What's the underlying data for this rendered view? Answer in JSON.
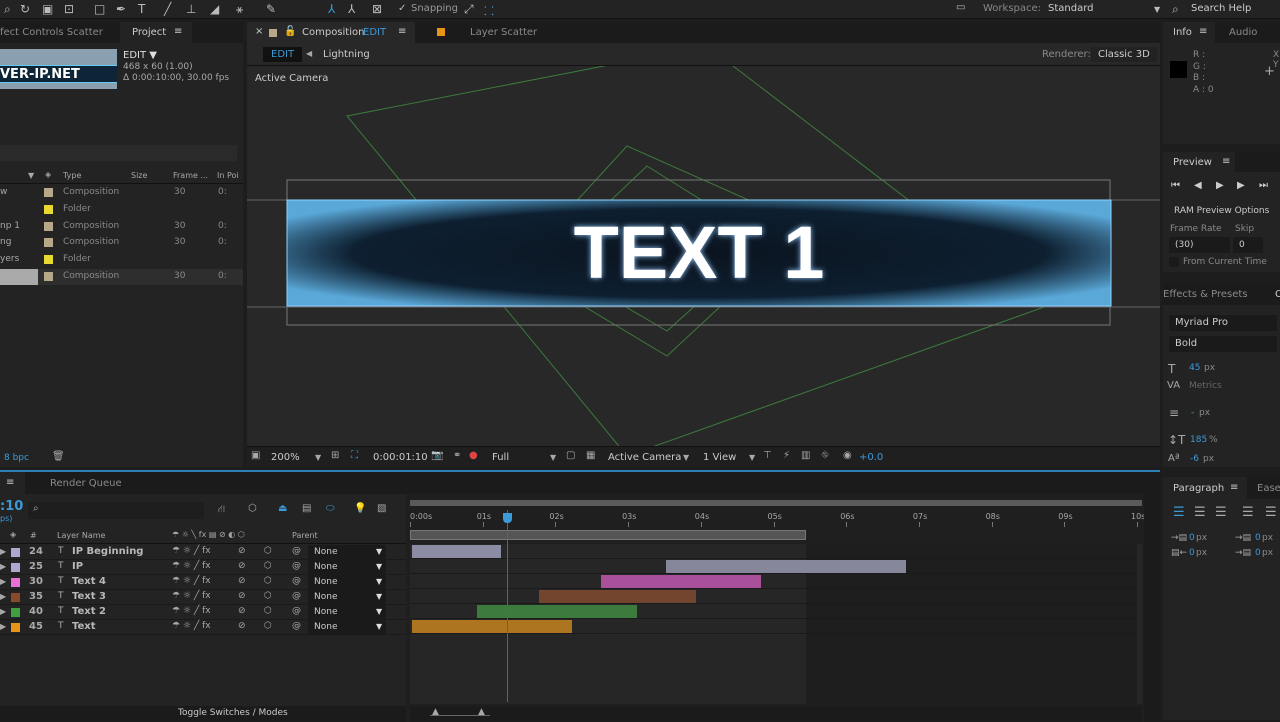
{
  "toolbar": {
    "snapping": "Snapping",
    "workspace_label": "Workspace:",
    "workspace": "Standard",
    "search": "Search Help"
  },
  "left": {
    "tab_effects": "fect Controls Scatter",
    "tab_project": "Project",
    "comp_name": "EDIT ▼",
    "comp_size": "468 x 60 (1.00)",
    "comp_duration": "Δ 0:00:10:00, 30.00 fps",
    "thumb_text": "VER-IP.NET",
    "columns": [
      "Type",
      "Size",
      "Frame ...",
      "In Poi"
    ],
    "items": [
      {
        "name": "w",
        "type": "Composition",
        "fr": "30",
        "in": "0:",
        "color": "#b8a88a"
      },
      {
        "name": "",
        "type": "Folder",
        "fr": "",
        "in": "",
        "color": "#e8d832"
      },
      {
        "name": "np 1",
        "type": "Composition",
        "fr": "30",
        "in": "0:",
        "color": "#b8a88a"
      },
      {
        "name": "ng",
        "type": "Composition",
        "fr": "30",
        "in": "0:",
        "color": "#b8a88a"
      },
      {
        "name": "yers",
        "type": "Folder",
        "fr": "",
        "in": "",
        "color": "#e8d832"
      },
      {
        "name": "",
        "type": "Composition",
        "fr": "30",
        "in": "0:",
        "color": "#b8a88a"
      }
    ],
    "bpc": "8 bpc"
  },
  "comp": {
    "tab": "Composition",
    "tab_name": "EDIT",
    "tab_layer": "Layer Scatter",
    "crumb_active": "EDIT",
    "crumb_next": "Lightning",
    "renderer_label": "Renderer:",
    "renderer": "Classic 3D",
    "view_label": "Active Camera",
    "banner_text": "TEXT 1",
    "footer": {
      "zoom": "200%",
      "timecode": "0:00:01:10",
      "resolution": "Full",
      "camera": "Active Camera",
      "views": "1 View",
      "exposure": "+0.0"
    }
  },
  "info": {
    "tab": "Info",
    "tab2": "Audio",
    "r": "R :",
    "g": "G :",
    "b": "B :",
    "a": "A : 0",
    "x": "X",
    "y": "Y"
  },
  "preview": {
    "tab": "Preview",
    "ram": "RAM Preview Options",
    "frame_rate_label": "Frame Rate",
    "skip_label": "Skip",
    "frame_rate": "(30)",
    "skip": "0",
    "from_current": "From Current Time"
  },
  "character": {
    "tab": "Effects & Presets",
    "tab2": "C",
    "font": "Myriad Pro",
    "style": "Bold",
    "size": "45",
    "size_unit": "px",
    "kerning": "Metrics",
    "leading": "-",
    "leading_unit": "px",
    "vscale": "185",
    "vscale_unit": "%",
    "baseline": "-6",
    "baseline_unit": "px"
  },
  "paragraph": {
    "tab": "Paragraph",
    "tab2": "Ease",
    "v1": "0",
    "v2": "0",
    "v3": "0",
    "v4": "0",
    "unit": "px"
  },
  "timeline": {
    "tab_render": "Render Queue",
    "timecode": ":10",
    "fps": "ps)",
    "col_num": "#",
    "col_name": "Layer Name",
    "col_parent": "Parent",
    "toggle": "Toggle Switches / Modes",
    "ticks": [
      "0:00s",
      "01s",
      "02s",
      "03s",
      "04s",
      "05s",
      "06s",
      "07s",
      "08s",
      "09s",
      "10s"
    ],
    "duration_s": 10,
    "playhead_s": 1.33,
    "work_area_end_s": 5.45,
    "layers": [
      {
        "num": "24",
        "name": "IP Beginning",
        "parent": "None",
        "color": "#aaaad0",
        "bar_color": "#8b8ba3",
        "start": 0,
        "end": 1.23
      },
      {
        "num": "25",
        "name": "IP",
        "parent": "None",
        "color": "#aaaad0",
        "bar_color": "#87879b",
        "start": 3.5,
        "end": 6.8
      },
      {
        "num": "30",
        "name": "Text 4",
        "parent": "None",
        "color": "#e870d8",
        "bar_color": "#a8509a",
        "start": 2.6,
        "end": 4.8
      },
      {
        "num": "35",
        "name": "Text 3",
        "parent": "None",
        "color": "#8a4a2a",
        "bar_color": "#74452e",
        "start": 1.75,
        "end": 3.9
      },
      {
        "num": "40",
        "name": "Text 2",
        "parent": "None",
        "color": "#40a040",
        "bar_color": "#3d7a3d",
        "start": 0.9,
        "end": 3.1
      },
      {
        "num": "45",
        "name": "Text",
        "parent": "None",
        "color": "#e89418",
        "bar_color": "#ad7520",
        "start": 0,
        "end": 2.2
      }
    ]
  }
}
